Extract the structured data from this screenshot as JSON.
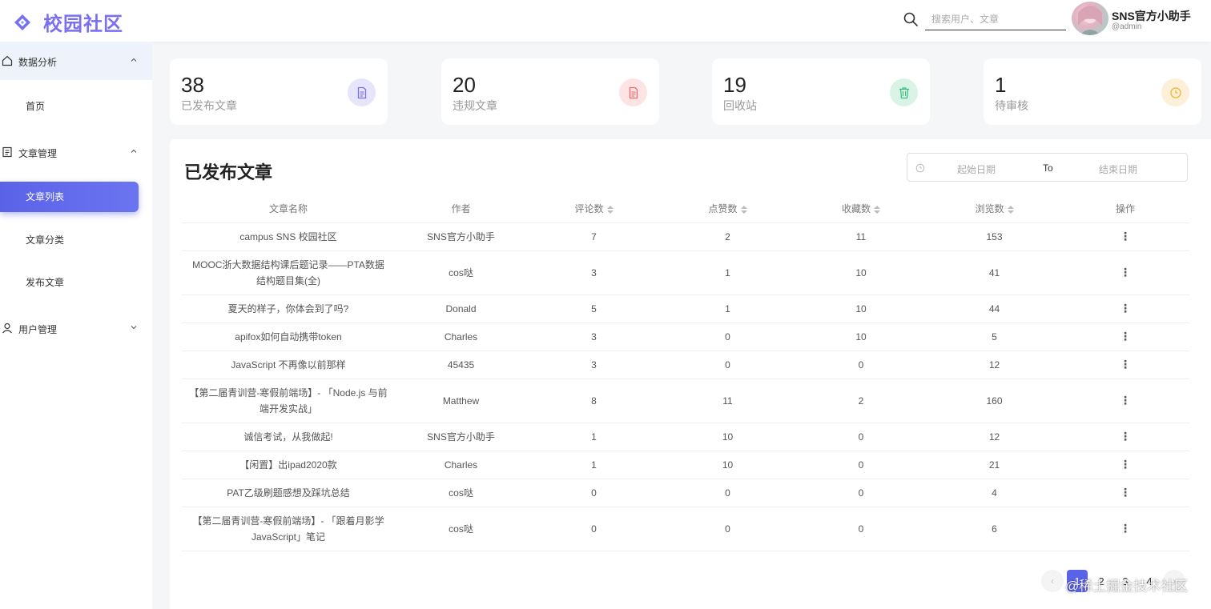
{
  "header": {
    "logo_text": "校园社区",
    "search_placeholder": "搜索用户、文章",
    "user_name": "SNS官方小助手",
    "user_handle": "@admin"
  },
  "sidebar": {
    "groups": [
      {
        "label": "数据分析",
        "items": [
          "首页"
        ]
      },
      {
        "label": "文章管理",
        "items": [
          "文章列表",
          "文章分类",
          "发布文章"
        ]
      },
      {
        "label": "用户管理",
        "items": []
      }
    ]
  },
  "stats": [
    {
      "value": "38",
      "label": "已发布文章",
      "icon": "document-icon",
      "color": "#7a6ff0",
      "bg": "#e7e5fb"
    },
    {
      "value": "20",
      "label": "违规文章",
      "icon": "document-icon",
      "color": "#f06a6a",
      "bg": "#fde3e3"
    },
    {
      "value": "19",
      "label": "回收站",
      "icon": "trash-icon",
      "color": "#3cbf7e",
      "bg": "#d9f4e6"
    },
    {
      "value": "1",
      "label": "待审核",
      "icon": "clock-icon",
      "color": "#f5b236",
      "bg": "#fdf0d8"
    }
  ],
  "panel": {
    "title": "已发布文章",
    "date_start_placeholder": "起始日期",
    "date_to": "To",
    "date_end_placeholder": "结束日期"
  },
  "table": {
    "columns": [
      "文章名称",
      "作者",
      "评论数",
      "点赞数",
      "收藏数",
      "浏览数",
      "操作"
    ],
    "rows": [
      {
        "title": "campus SNS 校园社区",
        "author": "SNS官方小助手",
        "comments": "7",
        "likes": "2",
        "favorites": "11",
        "views": "153"
      },
      {
        "title": "MOOC浙大数据结构课后题记录——PTA数据结构题目集(全)",
        "author": "cos哒",
        "comments": "3",
        "likes": "1",
        "favorites": "10",
        "views": "41"
      },
      {
        "title": "夏天的样子，你体会到了吗?",
        "author": "Donald",
        "comments": "5",
        "likes": "1",
        "favorites": "10",
        "views": "44"
      },
      {
        "title": "apifox如何自动携带token",
        "author": "Charles",
        "comments": "3",
        "likes": "0",
        "favorites": "10",
        "views": "5"
      },
      {
        "title": "JavaScript 不再像以前那样",
        "author": "45435",
        "comments": "3",
        "likes": "0",
        "favorites": "0",
        "views": "12"
      },
      {
        "title": "【第二届青训营-寒假前端场】- 「Node.js 与前端开发实战」",
        "author": "Matthew",
        "comments": "8",
        "likes": "11",
        "favorites": "2",
        "views": "160"
      },
      {
        "title": "诚信考试，从我做起!",
        "author": "SNS官方小助手",
        "comments": "1",
        "likes": "10",
        "favorites": "0",
        "views": "12"
      },
      {
        "title": "【闲置】出ipad2020款",
        "author": "Charles",
        "comments": "1",
        "likes": "10",
        "favorites": "0",
        "views": "21"
      },
      {
        "title": "PAT乙级刷题感想及踩坑总结",
        "author": "cos哒",
        "comments": "0",
        "likes": "0",
        "favorites": "0",
        "views": "4"
      },
      {
        "title": "【第二届青训营-寒假前端场】- 「跟着月影学 JavaScript」笔记",
        "author": "cos哒",
        "comments": "0",
        "likes": "0",
        "favorites": "0",
        "views": "6"
      }
    ],
    "action_glyph": "⋮"
  },
  "pagination": {
    "prev": "‹",
    "pages": [
      "1",
      "2",
      "3",
      "4"
    ],
    "next": "›"
  },
  "watermark": "@稀土掘金技术社区"
}
